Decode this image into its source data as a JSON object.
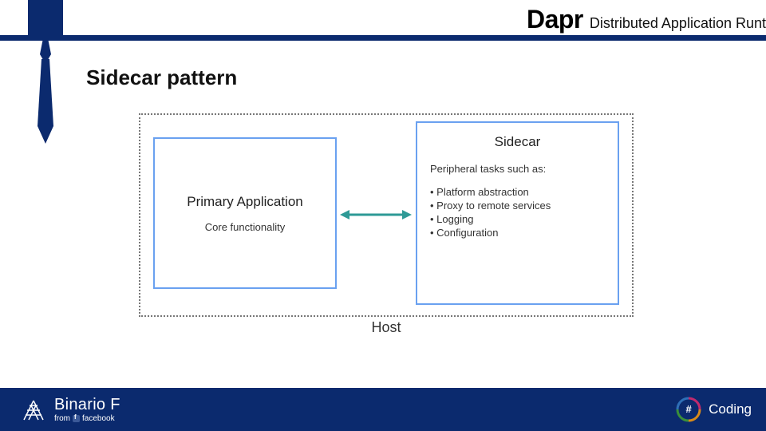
{
  "header": {
    "big": "Dapr",
    "sub": "Distributed Application Runt"
  },
  "section_title": "Sidecar pattern",
  "diagram": {
    "host_label": "Host",
    "primary": {
      "title": "Primary Application",
      "sub": "Core functionality"
    },
    "sidecar": {
      "title": "Sidecar",
      "tasks_intro": "Peripheral tasks such as:",
      "tasks": [
        "Platform abstraction",
        "Proxy to remote services",
        "Logging",
        "Configuration"
      ]
    }
  },
  "footer": {
    "brand": "Binario F",
    "from": "from",
    "fb": "facebook",
    "coding_symbol": "#",
    "coding": "Coding"
  },
  "colors": {
    "navy": "#0b2a6e",
    "border_blue": "#6aa1f0",
    "arrow_teal": "#2e9a96"
  }
}
